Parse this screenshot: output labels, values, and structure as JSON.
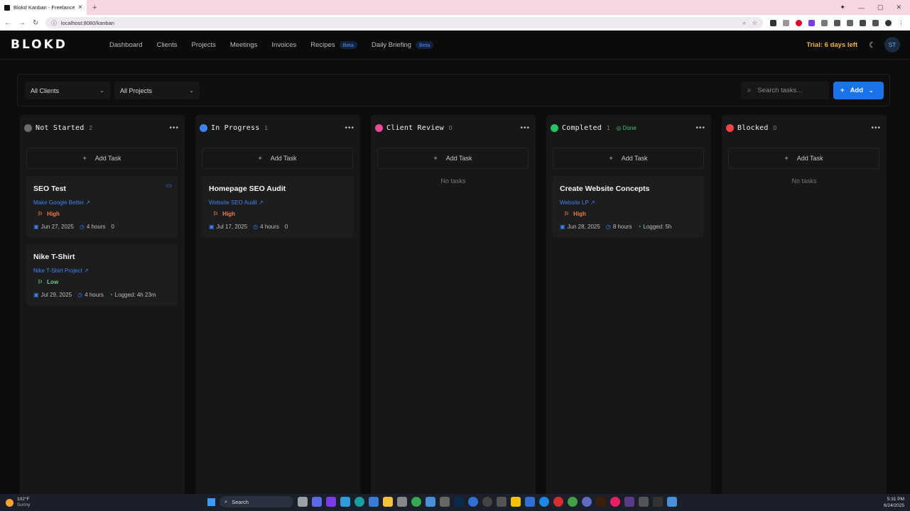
{
  "browser": {
    "tab_title": "Blokd Kanban - Freelancer Pro",
    "url": "localhost:8080/kanban"
  },
  "app": {
    "logo": "BLOKD",
    "nav": [
      {
        "label": "Dashboard"
      },
      {
        "label": "Clients"
      },
      {
        "label": "Projects"
      },
      {
        "label": "Meetings"
      },
      {
        "label": "Invoices"
      },
      {
        "label": "Recipes",
        "badge": "Beta"
      },
      {
        "label": "Daily Briefing",
        "badge": "Beta"
      }
    ],
    "trial": "Trial: 6 days left",
    "avatar": "ST"
  },
  "filters": {
    "clients": "All Clients",
    "projects": "All Projects",
    "search_placeholder": "Search tasks...",
    "add_label": "Add"
  },
  "columns": [
    {
      "title": "Not Started",
      "count": "2",
      "color": "#6b6b6b",
      "add_label": "Add Task",
      "cards": [
        {
          "title": "SEO Test",
          "project": "Make Google Better",
          "priority": "High",
          "date": "Jun 27, 2025",
          "hours": "4 hours",
          "comments": "0",
          "logged": ""
        },
        {
          "title": "Nike T-Shirt",
          "project": "Nike T-Shirt Project",
          "priority": "Low",
          "date": "Jul 29, 2025",
          "hours": "4 hours",
          "comments": "",
          "logged": "Logged: 4h 23m"
        }
      ]
    },
    {
      "title": "In Progress",
      "count": "1",
      "color": "#3b82f6",
      "add_label": "Add Task",
      "cards": [
        {
          "title": "Homepage SEO Audit",
          "project": "Website SEO Audit",
          "priority": "High",
          "date": "Jul 17, 2025",
          "hours": "4 hours",
          "comments": "0",
          "logged": ""
        }
      ]
    },
    {
      "title": "Client Review",
      "count": "0",
      "color": "#ec4899",
      "add_label": "Add Task",
      "empty": "No tasks",
      "cards": []
    },
    {
      "title": "Completed",
      "count": "1",
      "color": "#22c55e",
      "done": "Done",
      "add_label": "Add Task",
      "cards": [
        {
          "title": "Create Website Concepts",
          "project": "Website LP",
          "priority": "High",
          "date": "Jun 28, 2025",
          "hours": "8 hours",
          "comments": "",
          "logged": "Logged: 5h"
        }
      ]
    },
    {
      "title": "Blocked",
      "count": "0",
      "color": "#ef4444",
      "add_label": "Add Task",
      "empty": "No tasks",
      "cards": []
    }
  ],
  "taskbar": {
    "temp": "102°F",
    "weather": "Sunny",
    "search": "Search",
    "time": "5:31 PM",
    "date": "6/24/2025"
  }
}
